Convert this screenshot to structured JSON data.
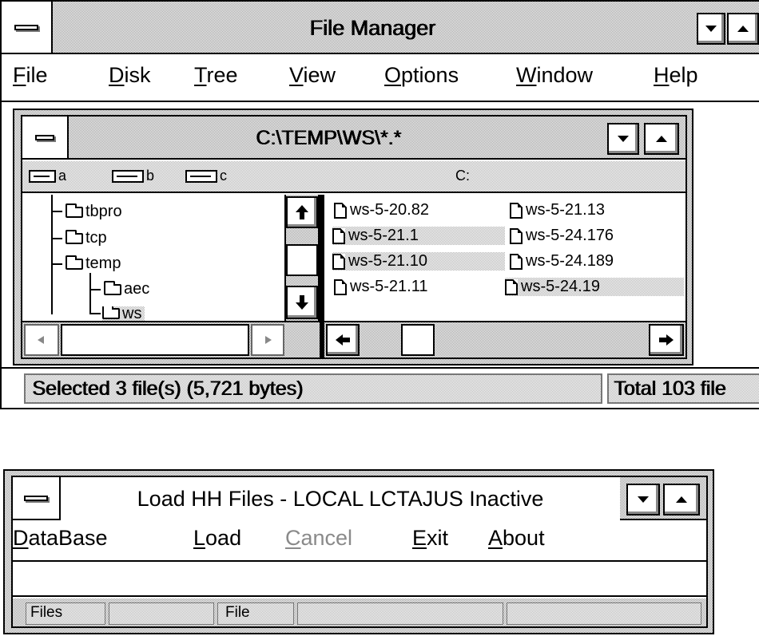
{
  "file_manager": {
    "title": "File Manager",
    "menu": {
      "file": {
        "key": "F",
        "rest": "ile"
      },
      "disk": {
        "key": "D",
        "rest": "isk"
      },
      "tree": {
        "key": "T",
        "rest": "ree"
      },
      "view": {
        "key": "V",
        "rest": "iew"
      },
      "options": {
        "key": "O",
        "rest": "ptions"
      },
      "window": {
        "key": "W",
        "rest": "indow"
      },
      "help": {
        "key": "H",
        "rest": "elp"
      }
    },
    "child_window": {
      "title": "C:\\TEMP\\WS\\*.*",
      "drives": [
        "a",
        "b",
        "c"
      ],
      "current_drive": "C:",
      "tree": [
        "tbpro",
        "tcp",
        "temp",
        "aec",
        "ws"
      ],
      "files_col1": [
        "ws-5-20.82",
        "ws-5-21.1",
        "ws-5-21.10",
        "ws-5-21.11"
      ],
      "files_col2": [
        "ws-5-21.13",
        "ws-5-24.176",
        "ws-5-24.189",
        "ws-5-24.19"
      ],
      "selected_files": [
        "ws-5-21.1",
        "ws-5-21.10",
        "ws-5-24.19"
      ]
    },
    "status_left": "Selected 3 file(s) (5,721 bytes)",
    "status_right": "Total 103 file"
  },
  "load_window": {
    "title": "Load HH Files - LOCAL LCTAJUS Inactive",
    "menu": {
      "database": {
        "key": "D",
        "rest": "ataBase"
      },
      "load": {
        "key": "L",
        "rest": "oad"
      },
      "cancel": {
        "key": "C",
        "rest": "ancel"
      },
      "exit": {
        "key": "E",
        "rest": "xit"
      },
      "about": {
        "key": "A",
        "rest": "bout"
      }
    },
    "status_files": "Files",
    "status_file": "File"
  }
}
